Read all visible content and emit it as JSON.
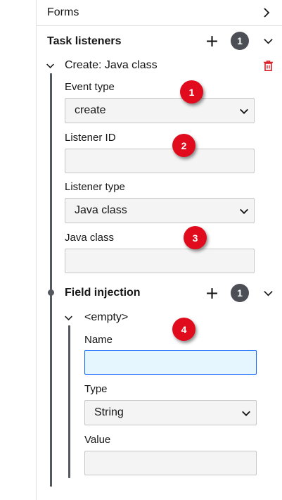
{
  "forms": {
    "label": "Forms"
  },
  "task_listeners": {
    "title": "Task listeners",
    "count": "1",
    "item": {
      "title": "Create: Java class",
      "event_type": {
        "label": "Event type",
        "value": "create"
      },
      "listener_id": {
        "label": "Listener ID",
        "value": ""
      },
      "listener_type": {
        "label": "Listener type",
        "value": "Java class"
      },
      "java_class": {
        "label": "Java class",
        "value": ""
      },
      "field_injection": {
        "title": "Field injection",
        "count": "1",
        "item": {
          "title": "<empty>",
          "name": {
            "label": "Name",
            "value": ""
          },
          "type": {
            "label": "Type",
            "value": "String"
          },
          "value": {
            "label": "Value",
            "value": ""
          }
        }
      }
    }
  },
  "callouts": [
    "1",
    "2",
    "3",
    "4"
  ],
  "colors": {
    "delete": "#da1e28",
    "callout": "#e00b1c",
    "badge": "#4c4f55",
    "focus": "#0f62fe"
  }
}
